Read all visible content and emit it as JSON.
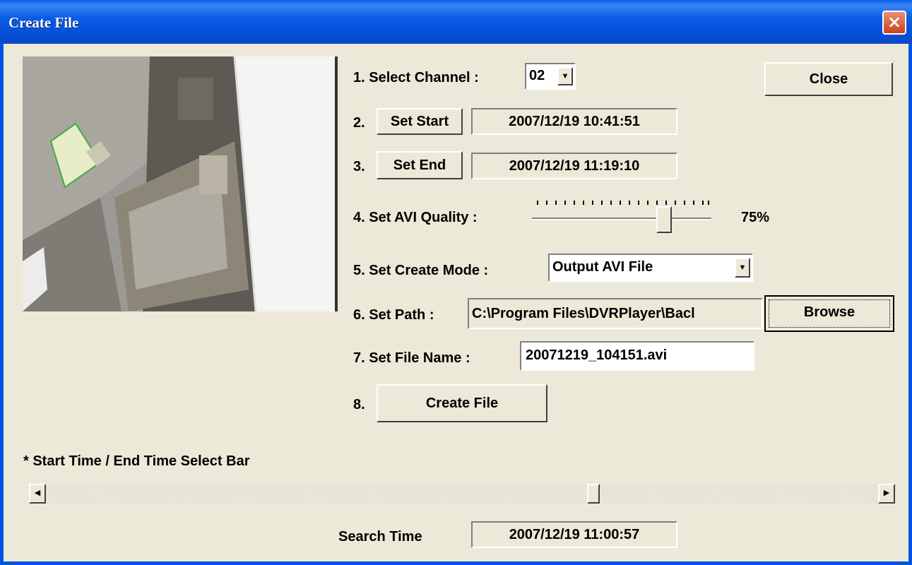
{
  "window": {
    "title": "Create File"
  },
  "preview": {
    "description": "camera-preview"
  },
  "channel": {
    "label": "1. Select Channel :",
    "value": "02"
  },
  "start": {
    "prefix": "2.",
    "button": "Set Start",
    "value": "2007/12/19 10:41:51"
  },
  "end": {
    "prefix": "3.",
    "button": "Set End",
    "value": "2007/12/19 11:19:10"
  },
  "quality": {
    "label": "4. Set AVI Quality :",
    "value_text": "75%",
    "value": 75
  },
  "mode": {
    "label": "5. Set Create Mode :",
    "value": "Output AVI File"
  },
  "path": {
    "label": "6. Set Path :",
    "value": "C:\\Program Files\\DVRPlayer\\Bacl",
    "browse": "Browse"
  },
  "filename": {
    "label": "7. Set File Name :",
    "value": "20071219_104151.avi"
  },
  "create": {
    "prefix": "8.",
    "button": "Create File"
  },
  "close_button": "Close",
  "timebar": {
    "label": "* Start Time / End Time Select Bar",
    "position": 0.66
  },
  "search": {
    "label": "Search Time",
    "value": "2007/12/19 11:00:57"
  },
  "colors": {
    "titlebar": "#0054e3",
    "face": "#ece9d8"
  }
}
